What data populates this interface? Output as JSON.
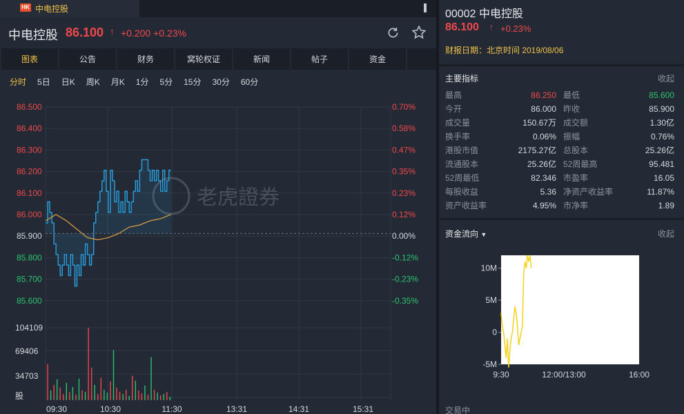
{
  "tab": {
    "badge": "HK",
    "title": "中电控股"
  },
  "header": {
    "name": "中电控股",
    "price": "86.100",
    "arrow": "↑",
    "change": "+0.200",
    "change_pct": "+0.23%"
  },
  "nav": [
    "图表",
    "公告",
    "财务",
    "窝轮权证",
    "新闻",
    "帖子",
    "资金"
  ],
  "periods": [
    "分时",
    "5日",
    "日K",
    "周K",
    "月K",
    "1分",
    "5分",
    "15分",
    "30分",
    "60分"
  ],
  "watermark": "老虎證券",
  "chart_data": [
    {
      "type": "line",
      "price_axis": [
        "86.500",
        "86.400",
        "86.300",
        "86.200",
        "86.100",
        "86.000",
        "85.900",
        "85.800",
        "85.700",
        "85.600"
      ],
      "pct_axis": [
        "0.70%",
        "0.58%",
        "0.47%",
        "0.35%",
        "0.23%",
        "0.12%",
        "0.00%",
        "-0.12%",
        "-0.23%",
        "-0.35%"
      ],
      "vol_axis": [
        "104109",
        "69406",
        "34703",
        "股"
      ],
      "x_ticks": [
        "09:30",
        "10:30",
        "11:30",
        "13:31",
        "14:31",
        "15:31"
      ],
      "prev_close": 85.9,
      "ylim": [
        85.6,
        86.5
      ],
      "x_range_minutes": [
        0,
        330
      ],
      "price_series": {
        "minutes": [
          0,
          2,
          4,
          6,
          8,
          10,
          12,
          14,
          16,
          18,
          20,
          22,
          24,
          26,
          28,
          30,
          32,
          34,
          36,
          38,
          40,
          42,
          44,
          46,
          48,
          50,
          52,
          54,
          56,
          58,
          60,
          62,
          64,
          66,
          68,
          70,
          72,
          74,
          76,
          78,
          80,
          82,
          84,
          86,
          88,
          90,
          92,
          94,
          96,
          98,
          100,
          102,
          104,
          106,
          108,
          110,
          112,
          114,
          116,
          118,
          120
        ],
        "values": [
          85.95,
          86.05,
          86.0,
          85.95,
          85.85,
          85.8,
          85.75,
          85.7,
          85.75,
          85.8,
          85.75,
          85.7,
          85.8,
          85.75,
          85.65,
          85.75,
          85.7,
          85.8,
          85.75,
          85.85,
          85.8,
          85.75,
          85.8,
          85.95,
          86.0,
          86.05,
          86.1,
          86.15,
          86.2,
          86.1,
          86.0,
          86.2,
          86.15,
          86.05,
          86.1,
          86.0,
          86.05,
          86.0,
          86.1,
          86.05,
          86.0,
          86.05,
          86.1,
          86.15,
          86.1,
          86.2,
          86.25,
          86.25,
          86.25,
          86.2,
          86.15,
          86.2,
          86.15,
          86.2,
          86.15,
          86.1,
          86.2,
          86.1,
          86.15,
          86.2,
          86.2
        ]
      },
      "avg_series": {
        "minutes": [
          0,
          10,
          20,
          30,
          40,
          50,
          60,
          70,
          80,
          90,
          100,
          110,
          120
        ],
        "values": [
          85.96,
          85.99,
          85.96,
          85.92,
          85.88,
          85.87,
          85.88,
          85.9,
          85.93,
          85.94,
          85.96,
          85.97,
          85.99
        ]
      },
      "volume": {
        "minutes": [
          2,
          5,
          8,
          11,
          14,
          17,
          20,
          23,
          26,
          29,
          32,
          35,
          38,
          41,
          44,
          47,
          50,
          53,
          56,
          59,
          62,
          65,
          68,
          71,
          74,
          77,
          80,
          83,
          86,
          89,
          92,
          95,
          98,
          101,
          104,
          107,
          110,
          113,
          116,
          119
        ],
        "values": [
          52000,
          14000,
          22000,
          30000,
          18000,
          9000,
          25000,
          12000,
          19000,
          8000,
          31000,
          14000,
          12000,
          104000,
          47000,
          22000,
          9000,
          32000,
          15000,
          11000,
          27000,
          72000,
          18000,
          12000,
          9000,
          15000,
          6000,
          35000,
          28000,
          14000,
          10000,
          21000,
          8000,
          62000,
          15000,
          11000,
          7000,
          9000,
          12000,
          5000
        ],
        "up": [
          true,
          false,
          true,
          false,
          true,
          true,
          false,
          true,
          false,
          true,
          false,
          true,
          false,
          true,
          true,
          false,
          true,
          true,
          false,
          false,
          true,
          false,
          true,
          true,
          false,
          true,
          false,
          true,
          false,
          true,
          true,
          false,
          true,
          false,
          true,
          false,
          true,
          false,
          true,
          false
        ]
      }
    },
    {
      "type": "line",
      "y_ticks": [
        "10M",
        "5M",
        "0",
        "-5M"
      ],
      "x_ticks": [
        "9:30",
        "12:00/13:00",
        "16:00"
      ],
      "ylim": [
        -5,
        12
      ],
      "series": [
        {
          "minutes": [
            0,
            3,
            6,
            9,
            12,
            15,
            18,
            21,
            24,
            27,
            30,
            33,
            36,
            39,
            42,
            45,
            48,
            51,
            54,
            57,
            60,
            63,
            66,
            69,
            72
          ],
          "values": [
            3,
            1,
            0,
            -2,
            -4,
            -1,
            -5.5,
            -3,
            -1,
            0,
            2,
            4,
            3,
            1,
            -2,
            -1,
            0,
            1,
            9,
            11,
            10,
            12,
            11,
            12,
            10
          ]
        }
      ]
    }
  ],
  "right": {
    "code": "00002 中电控股",
    "price": "86.100",
    "arrow": "↑",
    "change_pct": "+0.23%",
    "report": "财报日期：北京时间 2019/08/06",
    "indicators_title": "主要指标",
    "collapse": "收起",
    "indicators": [
      [
        "最高",
        "86.250",
        "最低",
        "85.600"
      ],
      [
        "今开",
        "86.000",
        "昨收",
        "85.900"
      ],
      [
        "成交量",
        "150.67万",
        "成交额",
        "1.30亿"
      ],
      [
        "换手率",
        "0.06%",
        "振幅",
        "0.76%"
      ],
      [
        "港股市值",
        "2175.27亿",
        "总股本",
        "25.26亿"
      ],
      [
        "流通股本",
        "25.26亿",
        "52周最高",
        "95.481"
      ],
      [
        "52周最低",
        "82.346",
        "市盈率",
        "16.05"
      ],
      [
        "每股收益",
        "5.36",
        "净资产收益率",
        "11.87%"
      ],
      [
        "资产收益率",
        "4.95%",
        "市净率",
        "1.89"
      ]
    ],
    "flow_title": "资金流向",
    "flow_collapse": "收起",
    "trading": "交易中"
  },
  "colors": {
    "up": "#f0484b",
    "down": "#2bc46e",
    "accent": "#f0c24a",
    "price_line": "#2a9fe0",
    "avg_line": "#e3a144",
    "flow_line": "#f2d21b"
  }
}
